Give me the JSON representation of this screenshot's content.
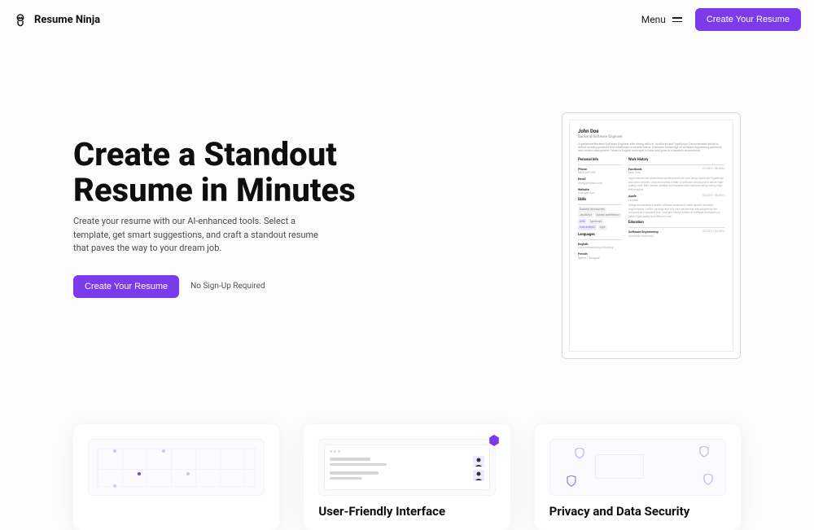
{
  "header": {
    "brand": "Resume Ninja",
    "menu_label": "Menu",
    "cta": "Create Your Resume"
  },
  "hero": {
    "title_line1": "Create a Standout",
    "title_line2": "Resume in Minutes",
    "description": "Create your resume with our AI-enhanced tools. Select a template, get smart suggestions, and craft a standout resume that paves the way to your dream job.",
    "cta": "Create Your Resume",
    "note": "No Sign-Up Required"
  },
  "resume": {
    "name": "John Doe",
    "role": "Backend Software Engineer",
    "summary": "Experienced Backend Software Engineer with strong skills in JavaScript and TypeScript. Demonstrated ability to deliver working products and collaborate in remote teams. Extensive knowledge of software engineering practices and modern deployment. Fluent in English and eager to learn and grow in a dynamic environment.",
    "personal_title": "Personal Info",
    "phone_label": "Phone",
    "phone_val": "0800 000 000",
    "email_label": "Email",
    "email_val": "john@johndoe.com",
    "website_label": "Website",
    "website_val": "example.com",
    "skills_title": "Skills",
    "skills": [
      "Backend development",
      "JavaScript",
      "System architecture",
      "AWS",
      "TypeScript",
      "Data analysis",
      "Agile"
    ],
    "languages_title": "Languages",
    "lang1_label": "English",
    "lang1_val": "Full professional proficiency",
    "lang2_label": "French",
    "lang2_val": "Native / Bilingual",
    "work_title": "Work History",
    "job1_company": "Facebook",
    "job1_dates": "07/2019 - 08/2024",
    "job1_location": "New York",
    "job1_desc": "Implemented new streamlined backend services code using JavaScript/TypeScript and microservices. Lead and mentor a team of software developers to deliver high-quality code. Built diverse scalable and reusable web solutions using cutting edge technologies.",
    "job2_company": "Apple",
    "job2_dates": "02/2016 - 06/2019",
    "job2_location": "London",
    "job2_desc": "Design and develop scalable software solutions to meet specific business requirements. Led the development of a core service that was adopted by the company as a standard tool. Lead and mentor a team of software developers to deliver high-quality and efficient code.",
    "education_title": "Education",
    "edu_degree": "Software Engineering",
    "edu_dates": "02/2014 - 04/2016",
    "edu_school": "Columbia University"
  },
  "features": {
    "f2_title": "User-Friendly Interface",
    "f3_title": "Privacy and Data Security"
  }
}
